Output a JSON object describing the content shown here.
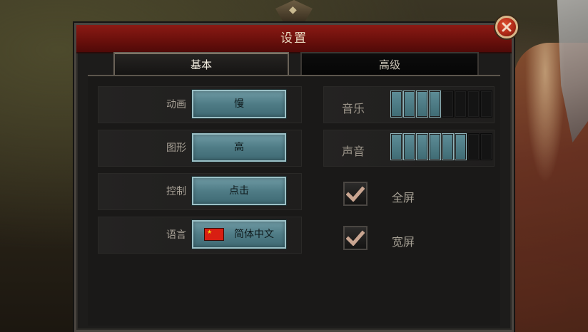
{
  "dialog": {
    "title": "设置",
    "tabs": [
      {
        "label": "基本",
        "active": true
      },
      {
        "label": "高级",
        "active": false
      }
    ]
  },
  "settings": [
    {
      "label": "动画",
      "value": "慢"
    },
    {
      "label": "图形",
      "value": "高"
    },
    {
      "label": "控制",
      "value": "点击"
    },
    {
      "label": "语言",
      "value": "简体中文",
      "icon": "china-flag-icon"
    }
  ],
  "audio": {
    "music": {
      "label": "音乐",
      "level": 4,
      "max": 8
    },
    "sound": {
      "label": "声音",
      "level": 6,
      "max": 8
    }
  },
  "display": {
    "fullscreen": {
      "label": "全屏",
      "checked": true
    },
    "widescreen": {
      "label": "宽屏",
      "checked": true
    }
  },
  "colors": {
    "title_bar": "#7a1510",
    "button_fill": "#5a8790",
    "segment_on": "#4f7c86",
    "check_mark": "#c9a591"
  }
}
